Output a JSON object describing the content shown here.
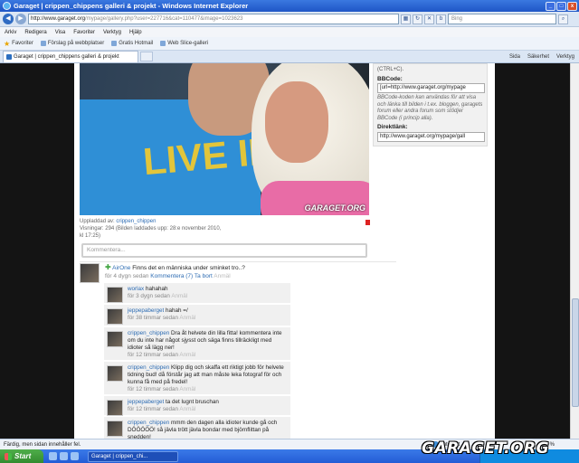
{
  "window": {
    "title": "Garaget | crippen_chippens galleri & projekt - Windows Internet Explorer",
    "min": "_",
    "max": "□",
    "close": "x"
  },
  "addressbar": {
    "url_host": "http://www.garaget.org",
    "url_path": "/mypage/gallery.php?user=227716&cat=110477&image=1023623",
    "search_placeholder": "Bing"
  },
  "menu": [
    "Arkiv",
    "Redigera",
    "Visa",
    "Favoriter",
    "Verktyg",
    "Hjälp"
  ],
  "favorites": {
    "label": "Favoriter",
    "items": [
      "Förslag på webbplatser",
      "Gratis Hotmail",
      "Web Slice-galleri"
    ]
  },
  "tab": {
    "label": "Garaget | crippen_chippens galleri & projekt",
    "tools": [
      "Sida",
      "Säkerhet",
      "Verktyg"
    ]
  },
  "photo": {
    "shirt_text": "LIVE IN TH",
    "watermark": "GARAGET.ORG"
  },
  "meta": {
    "uploaded_label": "Uppladdad av:",
    "uploader": "crippen_chippen",
    "views_line": "Visningar: 294 (Bilden laddades upp: 28:e november 2010,",
    "time_line": "kl 17:25)"
  },
  "comment_box": {
    "placeholder": "Kommentera..."
  },
  "sidebar": {
    "top_text": "(CTRL+C).",
    "bbcode_label": "BBCode:",
    "bbcode_value": "[url=http://www.garaget.org/mypage",
    "bbcode_desc": "BBCode-koden kan användas för att visa och länka till bilden i t.ex. bloggen, garagets forum eller andra forum som stödjer BBCode (i princip alla).",
    "direct_label": "Direktlänk:",
    "direct_value": "http://www.garaget.org/mypage/gall"
  },
  "main_comment": {
    "user": "AirOne",
    "text": "Finns det en människa under sminket tro..?",
    "time": "för 4 dygn sedan",
    "comment_link": "Kommentera (7)",
    "delete_link": "Ta bort",
    "report": "Anmäl"
  },
  "replies": [
    {
      "user": "worlax",
      "text": "hahahah",
      "time": "för 3 dygn sedan",
      "report": "Anmäl"
    },
    {
      "user": "jeppepaberget",
      "text": "hahah =/",
      "time": "för 38 timmar sedan",
      "report": "Anmäl"
    },
    {
      "user": "crippen_chippen",
      "text": "Dra åt helvete din lilla fitta! kommentera inte om du inte har något sjysst och säga finns tillräckligt med idioter så lägg ner!",
      "time": "för 12 timmar sedan",
      "report": "Anmäl"
    },
    {
      "user": "crippen_chippen",
      "text": "Klipp dig och skaffa ett riktigt jobb för helvete tidning bud! då förstår jag att man måste leka fotograf för och kunna få med på fredel!",
      "time": "för 12 timmar sedan",
      "report": "Anmäl"
    },
    {
      "user": "jeppepaberget",
      "text": "ta det lugnt bruschan",
      "time": "för 12 timmar sedan",
      "report": "Anmäl"
    },
    {
      "user": "crippen_chippen",
      "text": "mmm den dagen alla idioter kunde gå och DÖÖÖÖÖ! så jävla trött jävla bondar med björnflittan på snedden!",
      "time": "",
      "report": ""
    }
  ],
  "statusbar": {
    "text": "Färdig, men sidan innehåller fel.",
    "zone": "Internet",
    "zoom": "100 %"
  },
  "taskbar": {
    "start": "Start",
    "item": "Garaget | crippen_chi..."
  },
  "brand": "GARAGET.ORG"
}
